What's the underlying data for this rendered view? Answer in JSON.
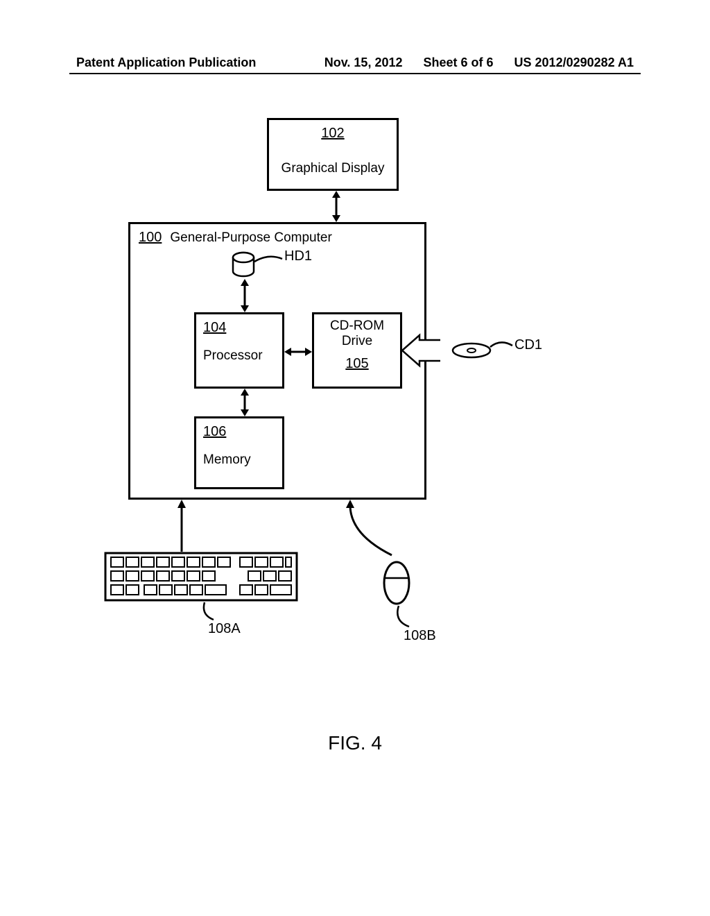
{
  "header": {
    "left": "Patent Application Publication",
    "date": "Nov. 15, 2012",
    "sheet": "Sheet 6 of 6",
    "pubnum": "US 2012/0290282 A1"
  },
  "display": {
    "ref": "102",
    "label": "Graphical Display"
  },
  "computer": {
    "ref": "100",
    "label": "General-Purpose Computer"
  },
  "processor": {
    "ref": "104",
    "label": "Processor"
  },
  "cdrom": {
    "label_top": "CD-ROM",
    "label_bottom": "Drive",
    "ref": "105"
  },
  "memory": {
    "ref": "106",
    "label": "Memory"
  },
  "hd_label": "HD1",
  "cd_label": "CD1",
  "keyboard_ref": "108A",
  "mouse_ref": "108B",
  "figure_caption": "FIG. 4"
}
